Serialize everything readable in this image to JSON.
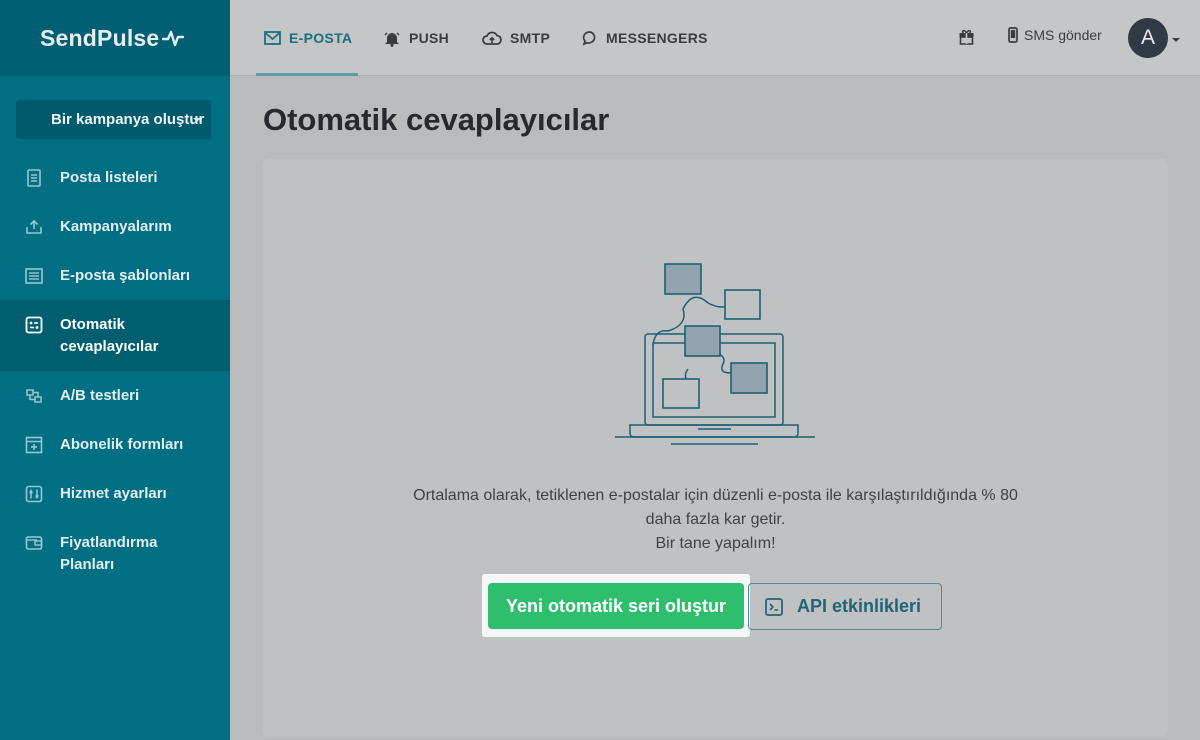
{
  "brand": {
    "name": "SendPulse"
  },
  "sidebar": {
    "campaign_button": "Bir kampanya oluştur",
    "items": [
      {
        "label": "Posta listeleri",
        "icon": "list-icon"
      },
      {
        "label": "Kampanyalarım",
        "icon": "send-icon"
      },
      {
        "label": "E-posta şablonları",
        "icon": "template-icon"
      },
      {
        "label": "Otomatik cevaplayıcılar",
        "icon": "automation-icon",
        "active": true
      },
      {
        "label": "A/B testleri",
        "icon": "ab-test-icon"
      },
      {
        "label": "Abonelik formları",
        "icon": "form-icon"
      },
      {
        "label": "Hizmet ayarları",
        "icon": "settings-icon"
      },
      {
        "label": "Fiyatlandırma Planları",
        "icon": "wallet-icon"
      }
    ]
  },
  "topbar": {
    "tabs": [
      {
        "label": "E-POSTA",
        "icon": "mail-icon",
        "active": true
      },
      {
        "label": "PUSH",
        "icon": "bell-icon"
      },
      {
        "label": "SMTP",
        "icon": "cloud-icon"
      },
      {
        "label": "MESSENGERS",
        "icon": "chat-icon"
      }
    ],
    "sms_label": "SMS gönder",
    "avatar_letter": "A"
  },
  "main": {
    "title": "Otomatik cevaplayıcılar",
    "description_line1": "Ortalama olarak, tetiklenen e-postalar için düzenli e-posta ile karşılaştırıldığında % 80",
    "description_line2": "daha fazla kar getir.",
    "description_line3": "Bir tane yapalım!",
    "primary_button": "Yeni otomatik seri oluştur",
    "secondary_button": "API etkinlikleri"
  },
  "colors": {
    "sidebar": "#006f84",
    "accent": "#1b6f82",
    "primary_button": "#2fbd6e"
  }
}
